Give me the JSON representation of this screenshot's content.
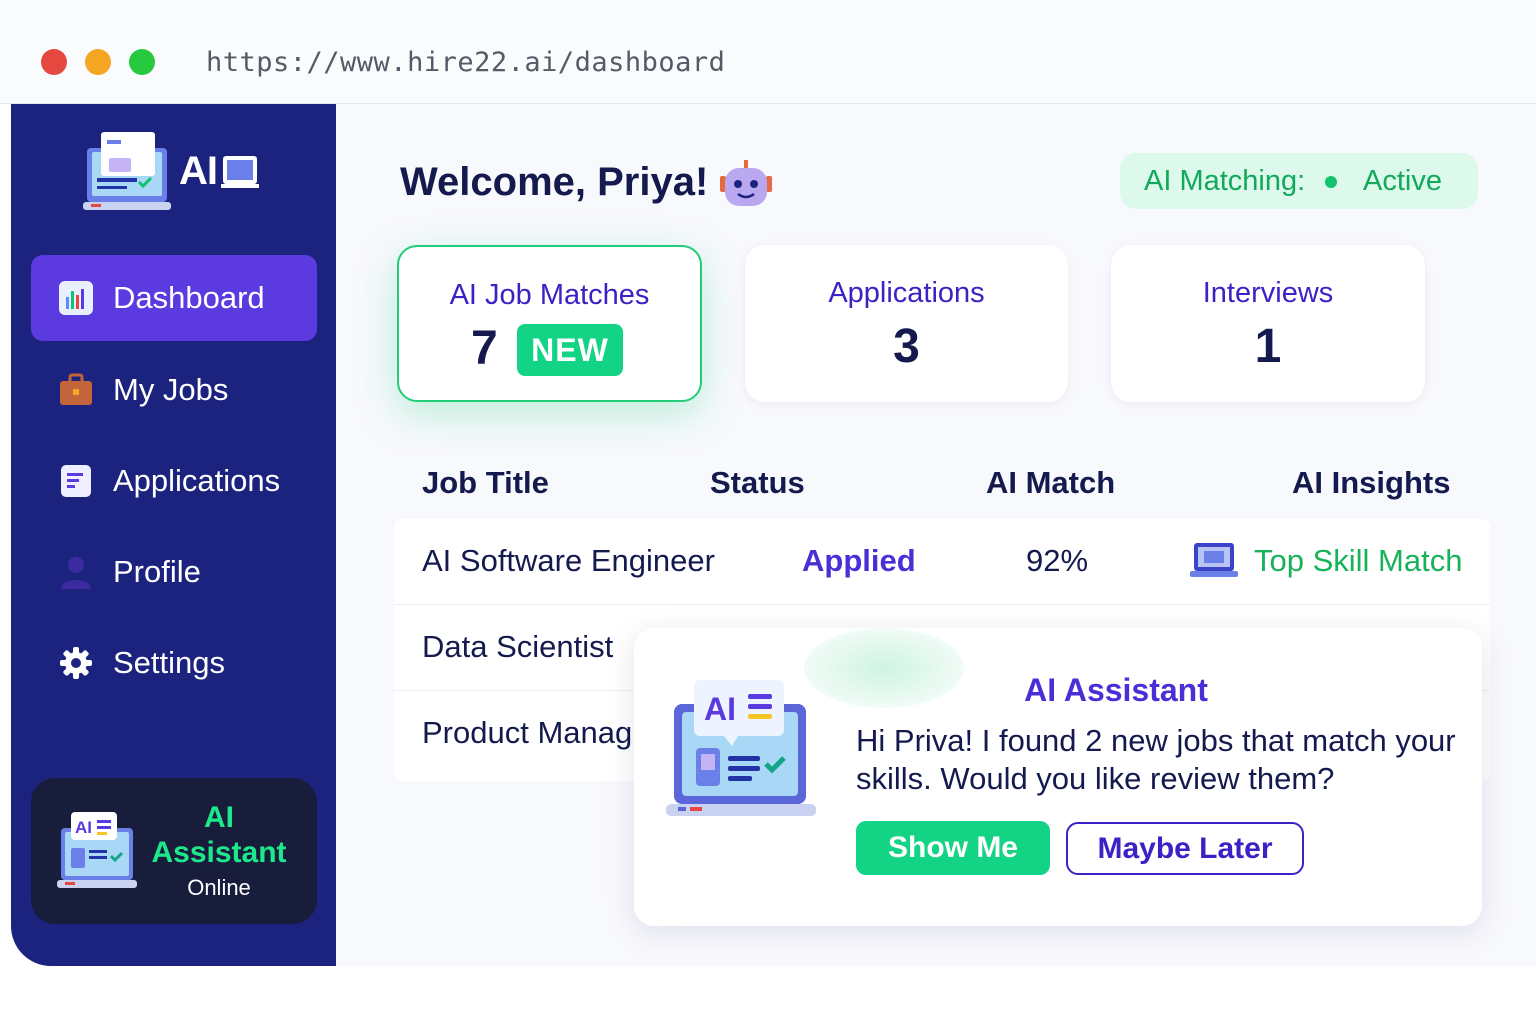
{
  "browser": {
    "url": "https://www.hire22.ai/dashboard"
  },
  "sidebar": {
    "logo_text": "AI",
    "items": [
      {
        "label": "Dashboard",
        "icon": "chart-icon",
        "active": true
      },
      {
        "label": "My Jobs",
        "icon": "briefcase-icon",
        "active": false
      },
      {
        "label": "Applications",
        "icon": "document-icon",
        "active": false
      },
      {
        "label": "Profile",
        "icon": "user-icon",
        "active": false
      },
      {
        "label": "Settings",
        "icon": "gear-icon",
        "active": false
      }
    ],
    "assistant": {
      "title": "AI Assistant",
      "status": "Online"
    }
  },
  "header": {
    "welcome": "Welcome, Priya!",
    "ai_matching_label": "AI Matching:",
    "ai_matching_value": "Active"
  },
  "stats": [
    {
      "label": "AI Job Matches",
      "value": "7",
      "badge": "NEW"
    },
    {
      "label": "Applications",
      "value": "3"
    },
    {
      "label": "Interviews",
      "value": "1"
    }
  ],
  "table": {
    "columns": [
      "Job Title",
      "Status",
      "AI Match",
      "AI Insights"
    ],
    "rows": [
      {
        "title": "AI Software Engineer",
        "status": "Applied",
        "match": "92%",
        "insight": "Top Skill Match"
      },
      {
        "title": "Data Scientist"
      },
      {
        "title": "Product Manag"
      }
    ]
  },
  "popup": {
    "title": "AI Assistant",
    "message": "Hi Priva! I found 2 new jobs that match your skills. Would you like review them?",
    "primary_button": "Show Me",
    "secondary_button": "Maybe Later"
  },
  "colors": {
    "sidebar": "#1c237f",
    "accent_purple": "#5b3be0",
    "accent_green": "#13d385",
    "text_dark": "#141a4d"
  }
}
